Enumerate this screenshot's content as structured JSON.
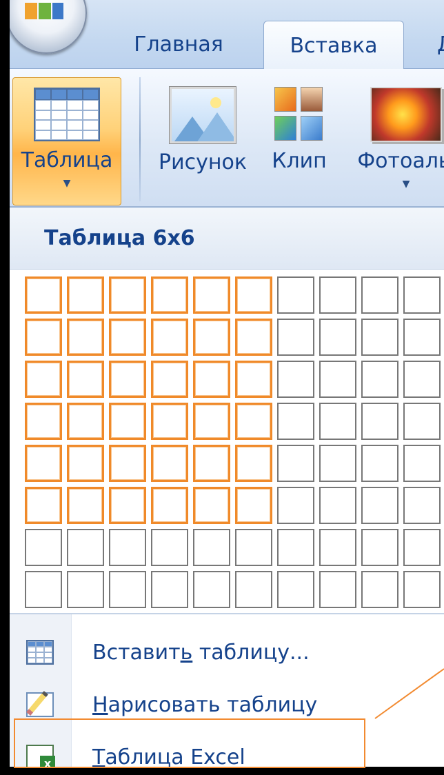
{
  "tabs": {
    "main": "Главная",
    "insert": "Вставка",
    "next_partial": "Д"
  },
  "ribbon": {
    "table": "Таблица",
    "picture": "Рисунок",
    "clip": "Клип",
    "photo_album": "Фотоалы"
  },
  "panel": {
    "title": "Таблица 6x6",
    "grid": {
      "columns": 10,
      "rows": 8,
      "selected_columns": 6,
      "selected_rows": 6
    }
  },
  "menu": {
    "insert_table": {
      "before": "Вставит",
      "accel": "ь",
      "after": " таблицу..."
    },
    "draw_table": {
      "accel": "Н",
      "after": "арисовать таблицу"
    },
    "excel_table": {
      "accel": "Т",
      "after": "аблица Excel"
    }
  },
  "colors": {
    "accent": "#f08a2a",
    "text": "#15428b"
  }
}
